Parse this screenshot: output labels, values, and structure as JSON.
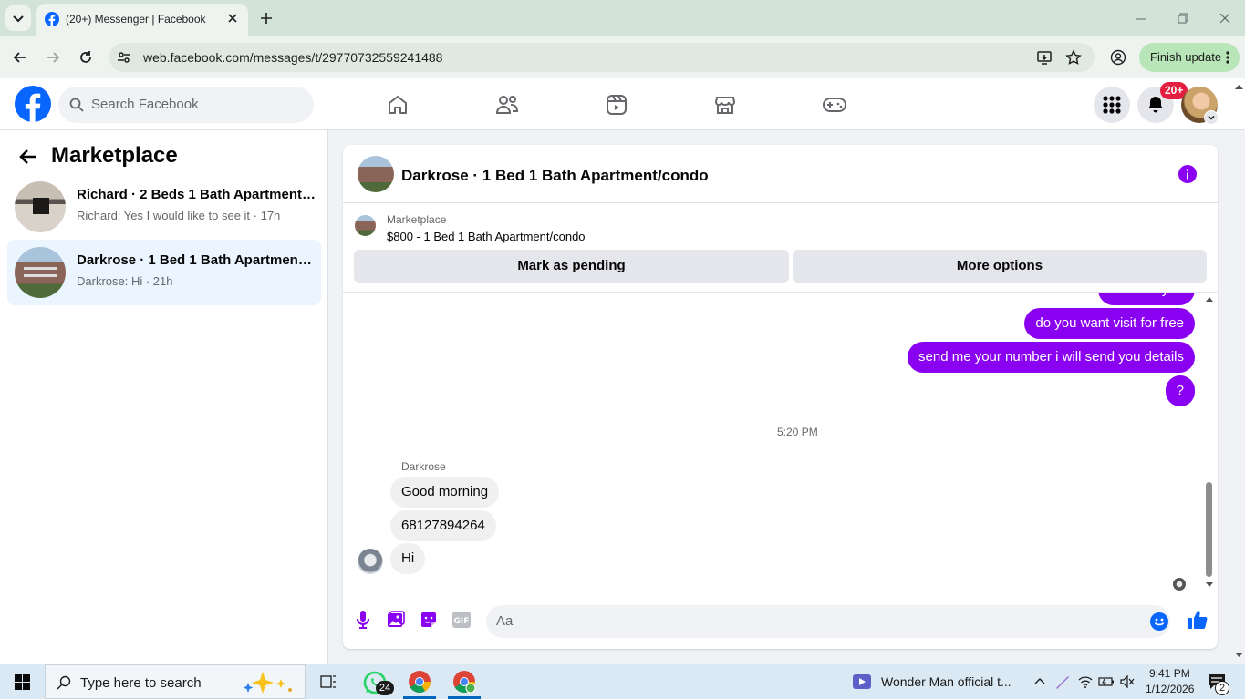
{
  "browser": {
    "tab_title": "(20+) Messenger | Facebook",
    "url": "web.facebook.com/messages/t/29770732559241488",
    "finish_update": "Finish update"
  },
  "fb": {
    "search_placeholder": "Search Facebook",
    "notifications_badge": "20+"
  },
  "left": {
    "title": "Marketplace",
    "conversations": [
      {
        "title": "Richard · 2 Beds 1 Bath Apartment/condo",
        "preview": "Richard: Yes I would like to see it · 17h",
        "active": false
      },
      {
        "title": "Darkrose · 1 Bed 1 Bath Apartment/condo",
        "preview": "Darkrose: Hi · 21h",
        "active": true
      }
    ]
  },
  "chat": {
    "header_title": "Darkrose · 1 Bed 1 Bath Apartment/condo",
    "listing_label": "Marketplace",
    "listing_title": "$800 - 1 Bed 1 Bath Apartment/condo",
    "mark_pending": "Mark as pending",
    "more_options": "More options",
    "outgoing_partial": "how are you",
    "outgoing": [
      "do you want visit for free",
      "send me your number i will send you details",
      "?"
    ],
    "timestamp": "5:20 PM",
    "sender_name": "Darkrose",
    "incoming": [
      "Good morning",
      "68127894264",
      "Hi"
    ],
    "composer_placeholder": "Aa",
    "colors": {
      "accent": "#8a00f0",
      "fb_blue": "#0866ff"
    }
  },
  "taskbar": {
    "search_placeholder": "Type here to search",
    "whatsapp_badge": "24",
    "media_title": "Wonder Man official t...",
    "time": "9:41 PM",
    "date": "1/12/2026",
    "notif_count": "2"
  }
}
